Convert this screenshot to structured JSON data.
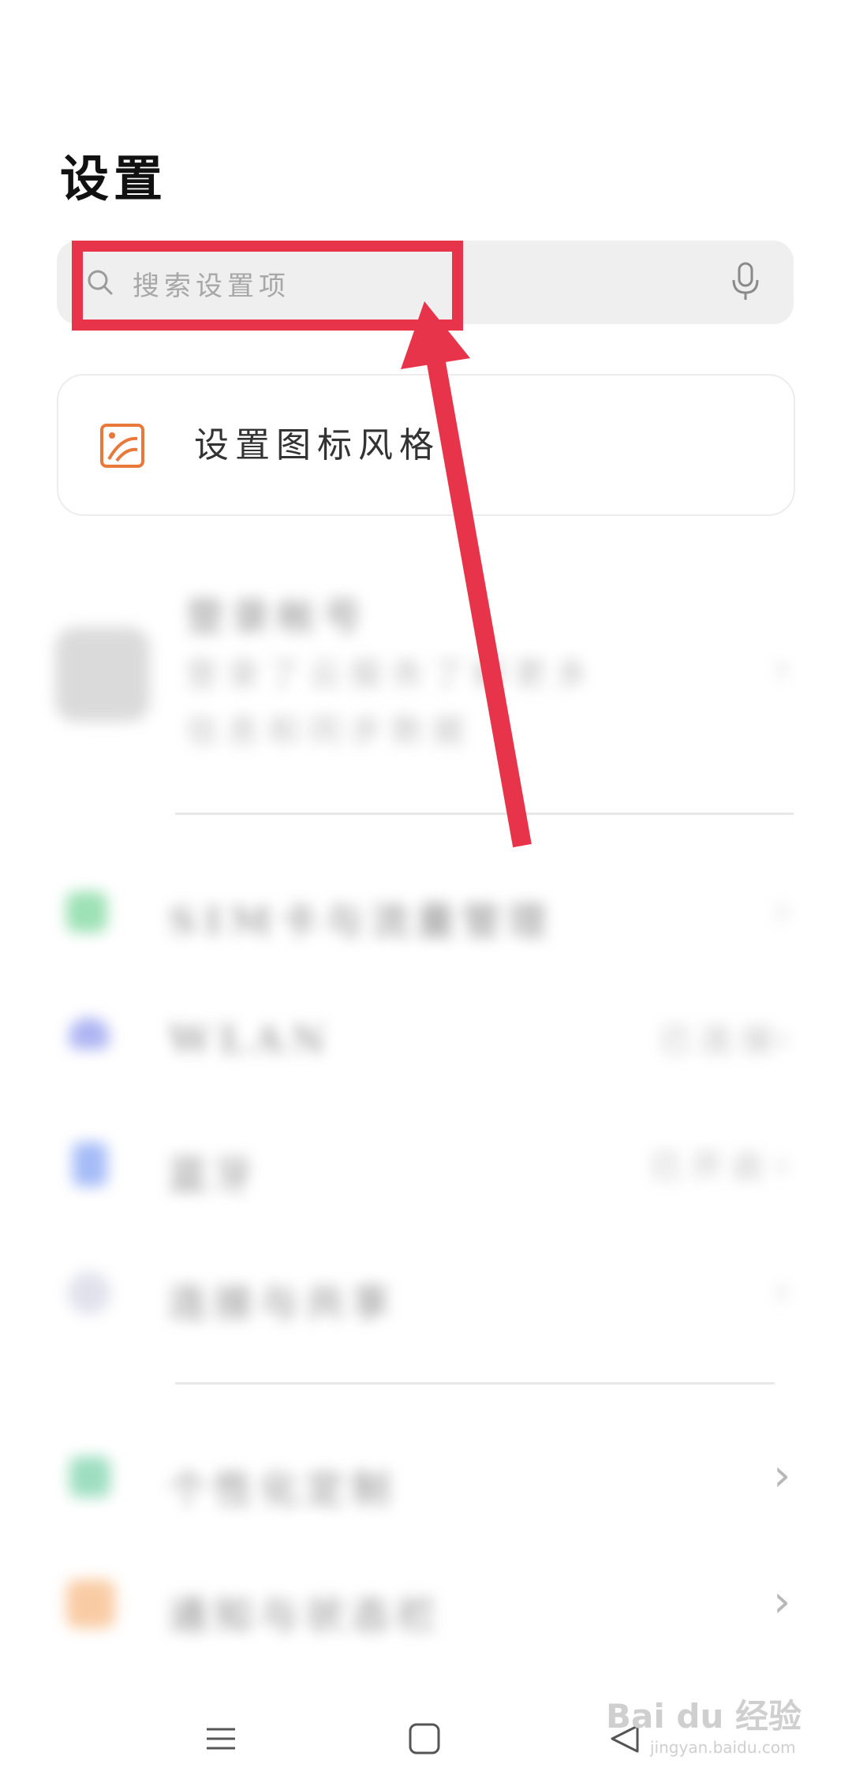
{
  "page": {
    "title": "设置"
  },
  "search": {
    "placeholder": "搜索设置项"
  },
  "suggestion": {
    "label": "设置图标风格"
  },
  "blurred_rows": [
    {
      "title": "登录帐号",
      "subtitle_1": "登录了云服务了解更多",
      "subtitle_2": "信息和同步数据"
    },
    {
      "title": "SIM卡与流量管理"
    },
    {
      "title": "WLAN",
      "value": "已连接"
    },
    {
      "title": "蓝牙",
      "value": "已开启"
    },
    {
      "title": "连接与共享"
    },
    {
      "title": "个性化定制"
    },
    {
      "title": "通知与状态栏"
    }
  ],
  "watermark": {
    "brand": "Bai du 经验",
    "url": "jingyan.baidu.com"
  },
  "colors": {
    "annotation_red": "#e8344a",
    "suggestion_icon": "#e9783b"
  }
}
